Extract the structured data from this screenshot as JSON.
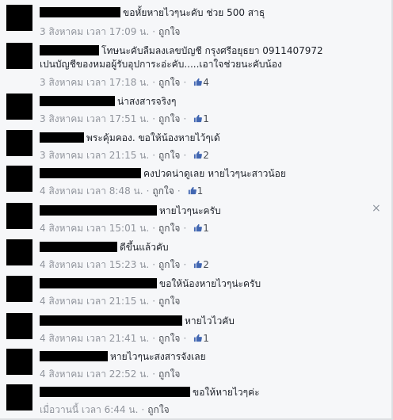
{
  "comments": [
    {
      "text": "ขอหั้ยหายไวๆนะคับ ช่วย 500 สาธุ",
      "time": "3 สิงหาคม เวลา 17:09 น.",
      "like": "ถูกใจ",
      "likes": ""
    },
    {
      "text": "โทษนะคับลืมลงเลขบัญชี กรุงศรีอยุธยา 0911407972",
      "text2": "เปนบัญชีของหมอผู้รับอุปการะอ่ะคับ.....เอาใจช่วยนะคับน้อง",
      "time": "3 สิงหาคม เวลา 17:18 น.",
      "like": "ถูกใจ",
      "likes": "4"
    },
    {
      "text": "น่าสงสารจริงๆ",
      "time": "3 สิงหาคม เวลา 17:51 น.",
      "like": "ถูกใจ",
      "likes": "1"
    },
    {
      "text": "พระคุ้มคอง. ขอให้น้องหายไว้ๆเด้",
      "time": "3 สิงหาคม เวลา 21:15 น.",
      "like": "ถูกใจ",
      "likes": "2"
    },
    {
      "text": "คงปวดน่าดูเลย หายไวๆนะสาวน้อย",
      "time": "4 สิงหาคม เวลา 8:48 น.",
      "like": "ถูกใจ",
      "likes": "1"
    },
    {
      "text": "หายไวๆนะครับ",
      "time": "4 สิงหาคม เวลา 15:01 น.",
      "like": "ถูกใจ",
      "likes": "1"
    },
    {
      "text": "ดีขึ้นแล้วคับ",
      "time": "4 สิงหาคม เวลา 15:23 น.",
      "like": "ถูกใจ",
      "likes": "2"
    },
    {
      "text": "ขอให้น้องหายไวๆน่ะครับ",
      "time": "4 สิงหาคม เวลา 21:15 น.",
      "like": "ถูกใจ",
      "likes": ""
    },
    {
      "text": "หายไวไวคับ",
      "time": "4 สิงหาคม เวลา 21:41 น.",
      "like": "ถูกใจ",
      "likes": "1"
    },
    {
      "text": "หายไวๆนะสงสารจังเลย",
      "time": "4 สิงหาคม เวลา 22:52 น.",
      "like": "ถูกใจ",
      "likes": ""
    },
    {
      "text": "ขอให้หายไวๆค่ะ",
      "time": "เมื่อวานนี้ เวลา 6:44 น.",
      "like": "ถูกใจ",
      "likes": ""
    }
  ],
  "close_symbol": "×",
  "colors": {
    "link": "#4267b2",
    "meta": "#90949c",
    "text": "#1d2129"
  }
}
